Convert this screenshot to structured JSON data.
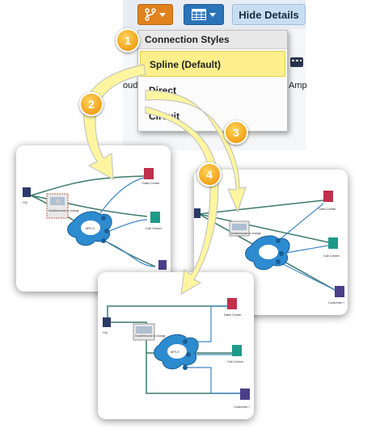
{
  "toolbar": {
    "hide_details_label": "Hide Details",
    "connection_icon": "connection-style-icon",
    "table_icon": "table-icon"
  },
  "background_text": {
    "left": "oud",
    "right": "Amp"
  },
  "menu": {
    "header": "Connection Styles",
    "items": [
      {
        "label": "Spline (Default)",
        "selected": true
      },
      {
        "label": "Direct",
        "selected": false
      },
      {
        "label": "Circuit",
        "selected": false
      }
    ]
  },
  "badges": [
    "1",
    "2",
    "3",
    "4"
  ],
  "diagram": {
    "hq": "HQ",
    "data_center": "Data Center",
    "call_center": "Call Center",
    "customer": "Customer I",
    "mpls": "MPLS",
    "doc_label": "Doublemouse in change"
  },
  "colors": {
    "toolbar_orange": "#e0821e",
    "toolbar_blue": "#2b74b8",
    "badge_orange": "#f2a21c",
    "selected_highlight": "#fdf08c",
    "arrow_fill": "#fdf5a0",
    "link_green": "#3c7a6a",
    "link_blue": "#3f86c6",
    "data_center_red": "#c0304a",
    "call_center_teal": "#1f9a8a",
    "customer_purple": "#4b3f8a"
  }
}
